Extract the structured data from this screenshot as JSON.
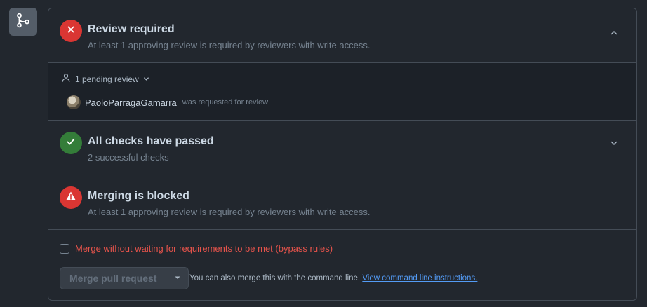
{
  "icons": {
    "git_badge": "git-branch-icon",
    "review": "x-icon",
    "checks": "check-icon",
    "blocked": "alert-icon",
    "collapse": "chevron-up-icon",
    "expand": "chevron-down-icon",
    "person": "person-icon",
    "dropdown": "triangle-down-icon"
  },
  "colors": {
    "review_status": "#e5534b",
    "checks_status": "#347d39",
    "blocked_status": "#e5534b",
    "link": "#539bf5",
    "bypass_text": "#e5534b"
  },
  "review": {
    "title": "Review required",
    "subtitle": "At least 1 approving review is required by reviewers with write access."
  },
  "pending": {
    "toggle_label": "1 pending review",
    "reviewer_name": "PaoloParragaGamarra",
    "reviewer_note": "was requested for review"
  },
  "checks": {
    "title": "All checks have passed",
    "subtitle": "2 successful checks"
  },
  "blocked": {
    "title": "Merging is blocked",
    "subtitle": "At least 1 approving review is required by reviewers with write access."
  },
  "merge": {
    "bypass_label": "Merge without waiting for requirements to be met (bypass rules)",
    "button_label": "Merge pull request",
    "command_line_text": "You can also merge this with the command line.",
    "command_line_link": "View command line instructions."
  }
}
